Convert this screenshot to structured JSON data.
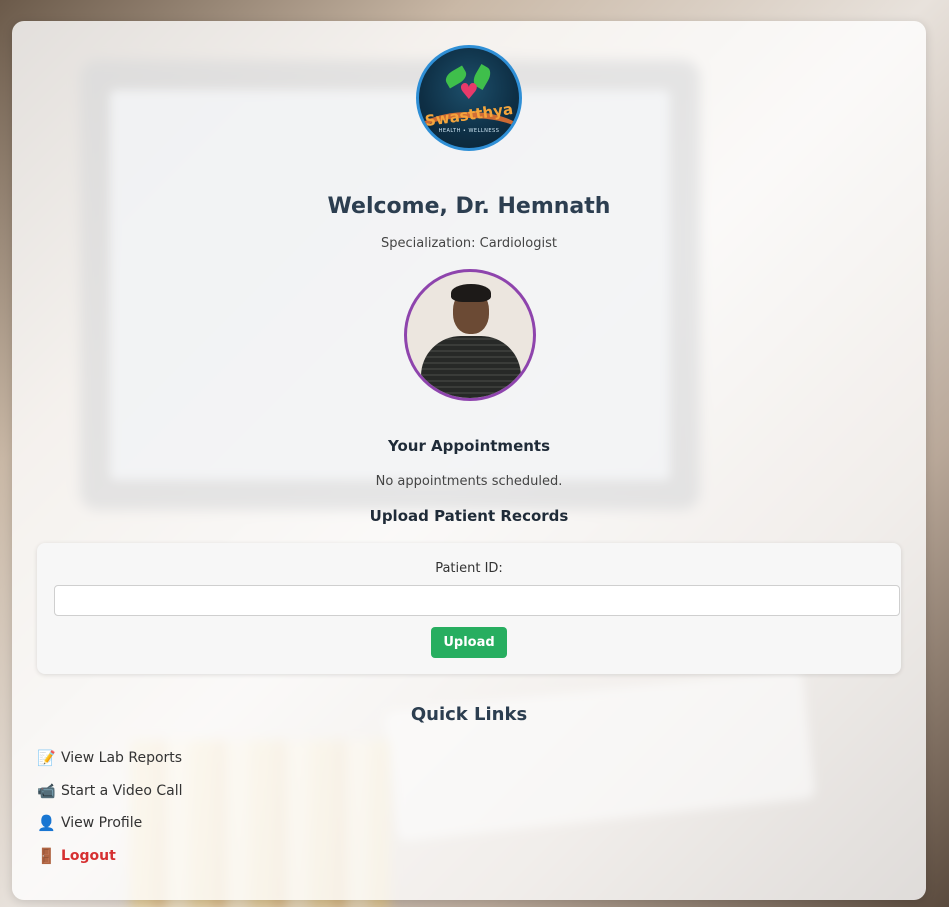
{
  "app": {
    "logo_text": "Swastthya",
    "logo_tagline": "HEALTH • WELLNESS"
  },
  "header": {
    "welcome": "Welcome, Dr. Hemnath",
    "specialization": "Specialization: Cardiologist"
  },
  "appointments": {
    "title": "Your Appointments",
    "empty_text": "No appointments scheduled."
  },
  "upload": {
    "title": "Upload Patient Records",
    "patient_id_label": "Patient ID:",
    "patient_id_value": "",
    "button_label": "Upload"
  },
  "quick_links": {
    "title": "Quick Links",
    "items": [
      {
        "icon": "memo-icon",
        "glyph": "📝",
        "label": "View Lab Reports"
      },
      {
        "icon": "video-call-icon",
        "glyph": "📹",
        "label": "Start a Video Call"
      },
      {
        "icon": "user-icon",
        "glyph": "👤",
        "label": "View Profile"
      },
      {
        "icon": "door-icon",
        "glyph": "🚪",
        "label": "Logout"
      }
    ]
  },
  "colors": {
    "logo_border": "#2f8fd6",
    "photo_border": "#8e44ad",
    "upload_button": "#27ae60",
    "logout_text": "#d63031",
    "heading": "#2c3e50"
  }
}
